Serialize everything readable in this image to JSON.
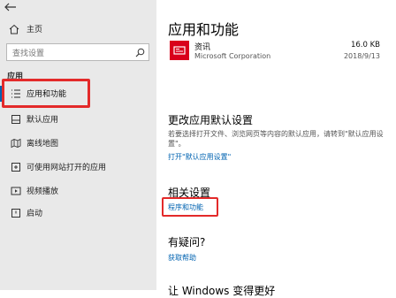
{
  "sidebar": {
    "home_label": "主页",
    "search_placeholder": "查找设置",
    "section_label": "应用",
    "items": [
      {
        "label": "应用和功能",
        "icon": "list-icon",
        "selected": true
      },
      {
        "label": "默认应用",
        "icon": "default-apps-icon",
        "selected": false
      },
      {
        "label": "离线地图",
        "icon": "offline-maps-icon",
        "selected": false
      },
      {
        "label": "可使用网站打开的应用",
        "icon": "web-apps-icon",
        "selected": false
      },
      {
        "label": "视频播放",
        "icon": "video-icon",
        "selected": false
      },
      {
        "label": "启动",
        "icon": "startup-icon",
        "selected": false
      }
    ]
  },
  "main": {
    "title": "应用和功能",
    "app": {
      "name": "资讯",
      "publisher": "Microsoft Corporation",
      "size": "16.0 KB",
      "date": "2018/9/13",
      "icon_color": "#d9001b"
    },
    "default_section": {
      "heading": "更改应用默认设置",
      "description": "若要选择打开文件、浏览网页等内容的默认应用，请转到\"默认应用设置\"。",
      "link": "打开\"默认应用设置\""
    },
    "related": {
      "heading": "相关设置",
      "link": "程序和功能"
    },
    "question": {
      "heading": "有疑问?",
      "link": "获取帮助"
    },
    "next_heading_partial": "让 Windows 变得更好"
  },
  "colors": {
    "accent": "#0063b1",
    "annotation_red": "#e32a2a",
    "sidebar_bg": "#e9e9e9"
  }
}
